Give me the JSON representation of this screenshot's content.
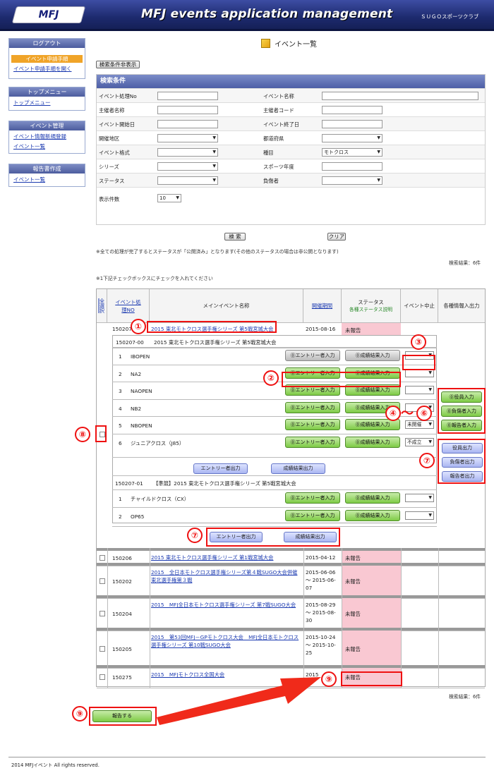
{
  "header": {
    "logo": "MFJ",
    "title": "MFJ events application management",
    "club": "ＳＵＧＯスポーツクラブ"
  },
  "sidebar": {
    "logout": "ログアウト",
    "box1": {
      "sub": "イベント申請手順",
      "link": "イベント申請手順を開く"
    },
    "box2": {
      "head": "トップメニュー",
      "link": "トップメニュー"
    },
    "box3": {
      "head": "イベント管理",
      "links": [
        "イベント情報新規登録",
        "イベント一覧"
      ]
    },
    "box4": {
      "head": "報告書作成",
      "link": "イベント一覧"
    }
  },
  "page": {
    "title": "イベント一覧",
    "toggle_btn": "検索条件非表示"
  },
  "search": {
    "caption": "検索条件",
    "fields": {
      "event_no": "イベント処理No",
      "event_name": "イベント名称",
      "org_name": "主催者名称",
      "org_code": "主催者コード",
      "start": "イベント開始日",
      "end": "イベント終了日",
      "region": "開催地区",
      "pref": "都道府県",
      "format": "イベント格式",
      "category": "種目",
      "category_value": "モトクロス",
      "series": "シリーズ",
      "year": "スポーツ年度",
      "status": "ステータス",
      "person": "負傷者",
      "count": "表示件数",
      "count_value": "10"
    },
    "search_btn": "検 索",
    "clear_btn": "クリア"
  },
  "notes": {
    "status_note": "※全ての処理が完了するとステータスが「公開済み」となります(その他のステータスの場合は非公開となります)",
    "result_count": "検索結果：6件",
    "check_note": "※1下記チェックボックスにチェックを入れてください"
  },
  "table": {
    "headers": {
      "all": "全選択",
      "no": "イベント処理NO",
      "name": "メインイベント名称",
      "date": "開催期間",
      "status": "ステータス",
      "status_sub": "各種ステータス説明",
      "cancel": "イベント中止",
      "output": "各種情報入出力"
    },
    "main": {
      "no": "150207",
      "name": "2015 東北モトクロス選手権シリーズ 第5戦宮城大会",
      "date": "2015-08-16",
      "status": "未報告"
    },
    "sub1": {
      "no": "150207-00",
      "name": "2015 東北モトクロス選手権シリーズ 第5戦宮城大会"
    },
    "classes1": [
      {
        "n": "1",
        "name": "IBOPEN",
        "sel": ""
      },
      {
        "n": "2",
        "name": "NA2",
        "sel": ""
      },
      {
        "n": "3",
        "name": "NAOPEN",
        "sel": ""
      },
      {
        "n": "4",
        "name": "NB2",
        "sel": ""
      },
      {
        "n": "5",
        "name": "NBOPEN",
        "sel": "未開催"
      },
      {
        "n": "6",
        "name": "ジュニアクロス（J85）",
        "sel": "不成立"
      }
    ],
    "entry_btn": "⓪エントリー者入力",
    "result_btn": "⓪成績結果入力",
    "entry_out": "エントリー者出力",
    "result_out": "成績結果出力",
    "sub2": {
      "no": "150207-01",
      "name": "【準競】2015 東北モトクロス選手権シリーズ 第5戦宮城大会"
    },
    "classes2": [
      {
        "n": "1",
        "name": "チャイルドクロス（CX）"
      },
      {
        "n": "2",
        "name": "OP65"
      }
    ],
    "side_in": [
      "⓪役員入力",
      "⓪負傷者入力",
      "⓪報告者入力"
    ],
    "side_out": [
      "役員出力",
      "負傷者出力",
      "報告者出力"
    ],
    "rows": [
      {
        "no": "150206",
        "name": "2015 東北モトクロス選手権シリーズ 第1戦宮城大会",
        "date": "2015-04-12",
        "status": "未報告"
      },
      {
        "no": "150202",
        "name": "2015　全日本モトクロス選手権シリーズ第４戦SUGO大会併催東北選手権第３戦",
        "date": "2015-06-06 ～ 2015-06-07",
        "status": "未報告"
      },
      {
        "no": "150204",
        "name": "2015　MFJ全日本モトクロス選手権シリーズ 第7戦SUGO大会",
        "date": "2015-08-29 ～ 2015-08-30",
        "status": "未報告"
      },
      {
        "no": "150205",
        "name": "2015　第53回MFJ－GPモトクロス大会　MFJ全日本モトクロス選手権シリーズ 第10戦SUGO大会",
        "date": "2015-10-24 ～ 2015-10-25",
        "status": "未報告"
      },
      {
        "no": "150275",
        "name": "2015　MFJモトクロス全国大会",
        "date": "2015",
        "status": "未報告"
      }
    ]
  },
  "report_btn": "報告する",
  "footer": "2014 MFJイベント All rights reserved.",
  "annotations": [
    "①",
    "②",
    "③",
    "④",
    "⑥",
    "⑦",
    "⑦",
    "⑧",
    "⑨",
    "⑨",
    "～"
  ],
  "colors": {
    "header": "#1d2a6e",
    "green": "#7ecb45",
    "pink": "#f9c8d2",
    "annot": "#e11111"
  }
}
